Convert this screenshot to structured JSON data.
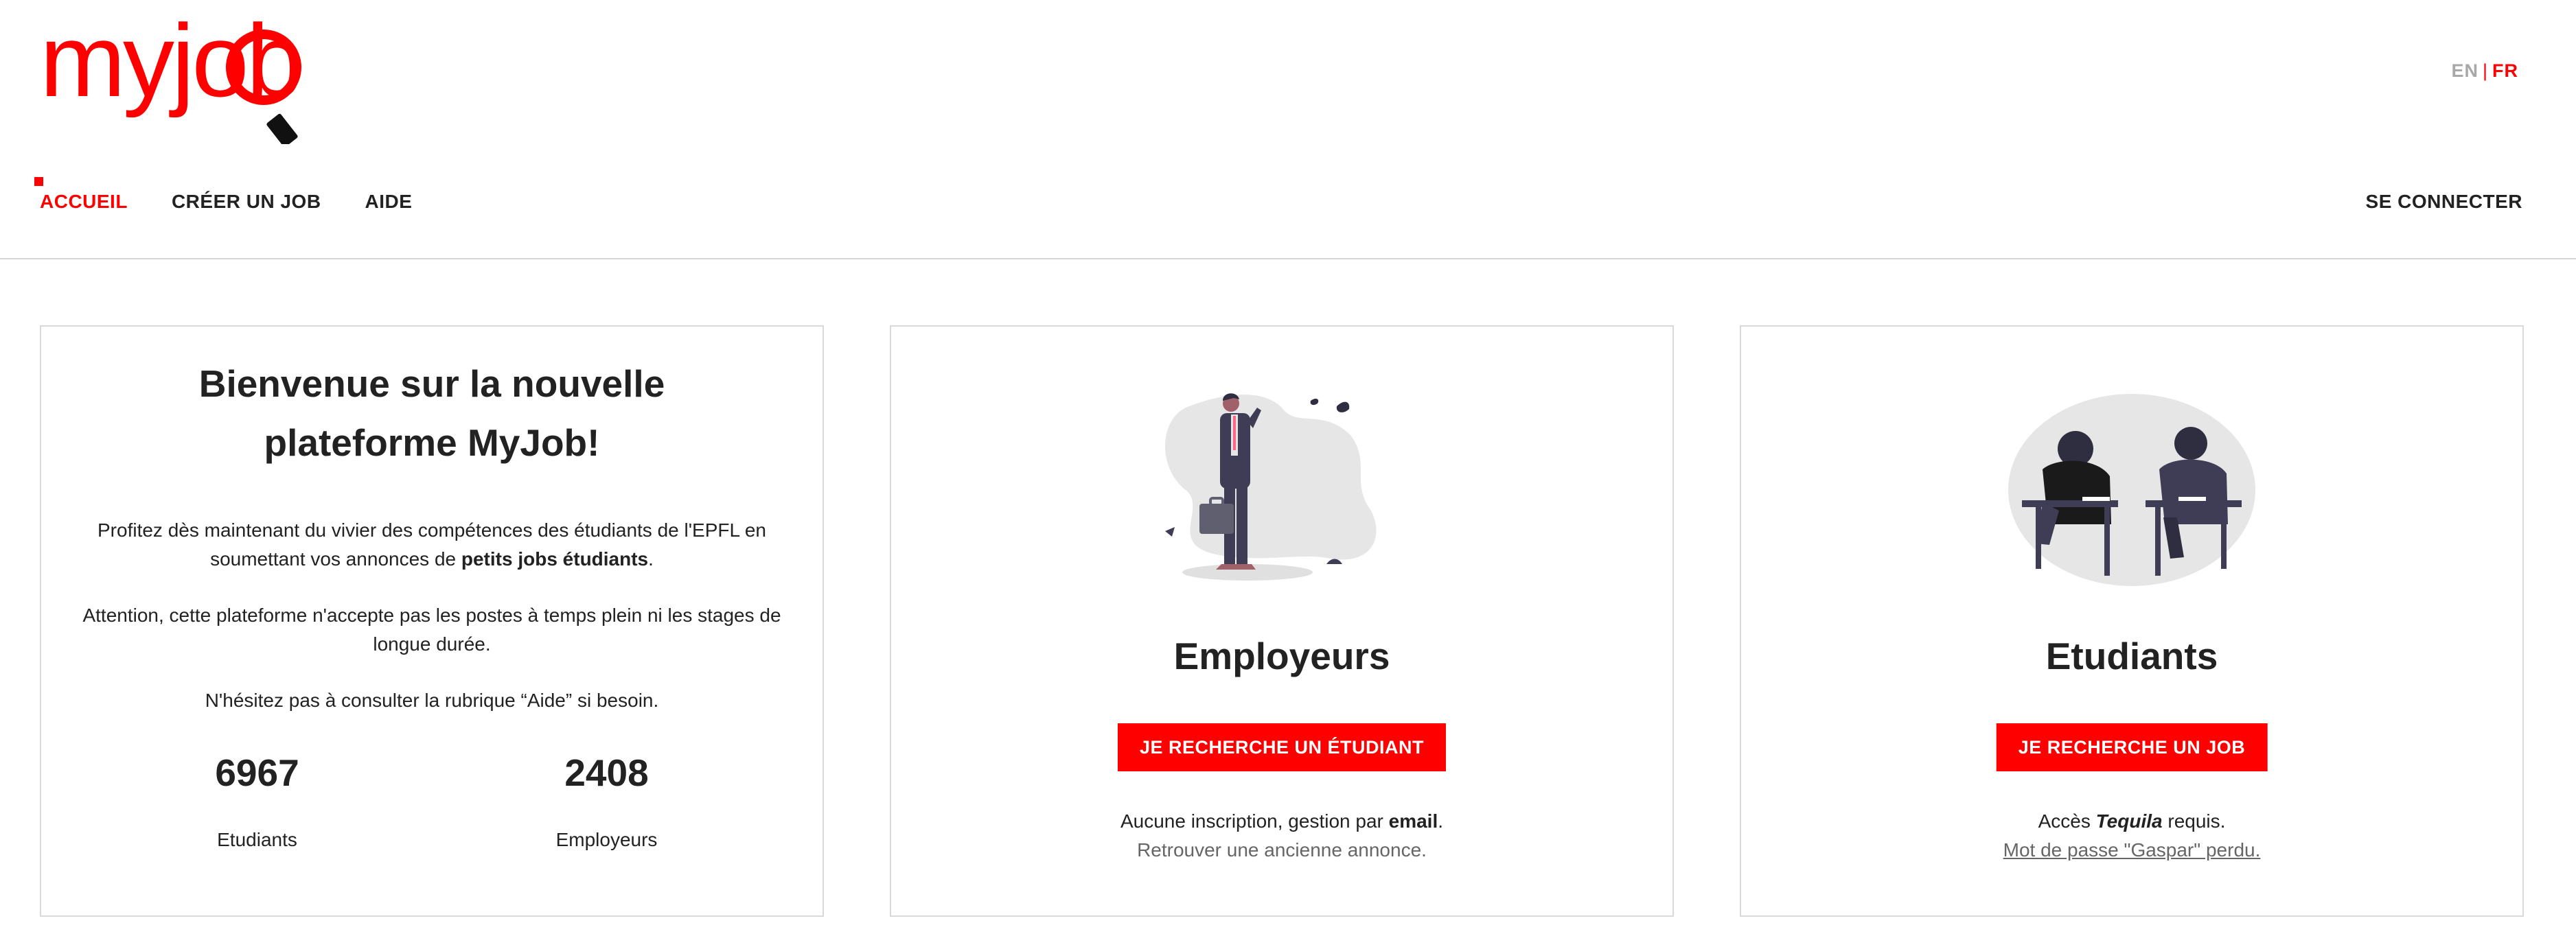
{
  "brand": {
    "logo_text": "myjob",
    "accent_color": "#ff0000"
  },
  "lang": {
    "en": "EN",
    "sep": "|",
    "fr": "FR"
  },
  "nav": {
    "items": [
      {
        "label": "ACCUEIL",
        "active": true
      },
      {
        "label": "CRÉER UN JOB",
        "active": false
      },
      {
        "label": "AIDE",
        "active": false
      }
    ],
    "login": "SE CONNECTER"
  },
  "welcome": {
    "title": "Bienvenue sur la nouvelle plateforme MyJob!",
    "p1_before": "Profitez dès maintenant du vivier des compétences des étudiants de l'EPFL en soumettant vos annonces de ",
    "p1_bold": "petits jobs étudiants",
    "p1_after": ".",
    "p2": "Attention, cette plateforme n'accepte pas les postes à temps plein ni les stages de longue durée.",
    "p3": "N'hésitez pas à consulter la rubrique “Aide” si besoin.",
    "stats": [
      {
        "value": "6967",
        "label": "Etudiants"
      },
      {
        "value": "2408",
        "label": "Employeurs"
      }
    ]
  },
  "employers": {
    "title": "Employeurs",
    "button": "JE RECHERCHE UN ÉTUDIANT",
    "note_before": "Aucune inscription, gestion par ",
    "note_bold": "email",
    "note_after": ".",
    "link": "Retrouver une ancienne annonce."
  },
  "students": {
    "title": "Etudiants",
    "button": "JE RECHERCHE UN JOB",
    "note_before": "Accès ",
    "note_bold": "Tequila",
    "note_after": " requis.",
    "link": "Mot de passe \"Gaspar\" perdu."
  }
}
